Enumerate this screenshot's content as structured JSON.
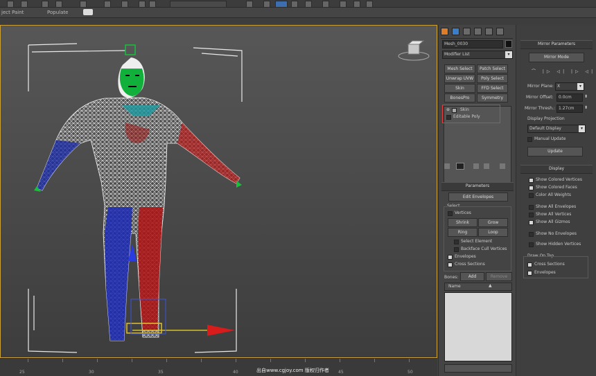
{
  "ribbon": {
    "tab_paint": "ject Paint",
    "tab_populate": "Populate"
  },
  "object_name": "Mesh_0030",
  "modifier_list": "Modifier List",
  "modifier_buttons": [
    "Mesh Select",
    "Patch Select",
    "Unwrap UVW",
    "Poly Select",
    "Skin",
    "FFD Select",
    "BonesPro",
    "Symmetry"
  ],
  "stack": [
    "Skin",
    "Editable Poly"
  ],
  "parameters": {
    "header": "Parameters",
    "edit_envelopes": "Edit Envelopes",
    "select_label": "Select",
    "vertices": "Vertices",
    "shrink": "Shrink",
    "grow": "Grow",
    "ring": "Ring",
    "loop": "Loop",
    "select_element": "Select Element",
    "backface_cull": "Backface Cull Vertices",
    "envelopes": "Envelopes",
    "cross_sections": "Cross Sections",
    "bones_label": "Bones:",
    "add": "Add",
    "remove": "Remove",
    "name_col": "Name"
  },
  "mirror": {
    "header": "Mirror Parameters",
    "mirror_mode": "Mirror Mode",
    "mirror_plane_label": "Mirror Plane:",
    "mirror_plane_value": "X",
    "mirror_offset_label": "Mirror Offset:",
    "mirror_offset_value": "0.0cm",
    "mirror_thresh_label": "Mirror Thresh.:",
    "mirror_thresh_value": "1.27cm",
    "display_projection_label": "Display Projection",
    "display_projection_value": "Default Display",
    "manual_update": "Manual Update",
    "update": "Update"
  },
  "display": {
    "header": "Display",
    "show_colored_vertices": "Show Colored Vertices",
    "show_colored_faces": "Show Colored Faces",
    "color_all_weights": "Color All Weights",
    "show_all_envelopes": "Show All Envelopes",
    "show_all_vertices": "Show All Vertices",
    "show_all_gizmos": "Show All Gizmos",
    "show_no_envelopes": "Show No Envelopes",
    "show_hidden_vertices": "Show Hidden Vertices",
    "draw_on_top": "Draw On Top",
    "cross_sections": "Cross Sections",
    "envelopes": "Envelopes"
  },
  "ruler_ticks": [
    "25",
    "30",
    "35",
    "40",
    "45",
    "50"
  ],
  "caption": "出自www.cgjoy.com 版权归作者",
  "colors": {
    "viewport_border": "#caa13a",
    "highlight": "#e53b3b"
  }
}
